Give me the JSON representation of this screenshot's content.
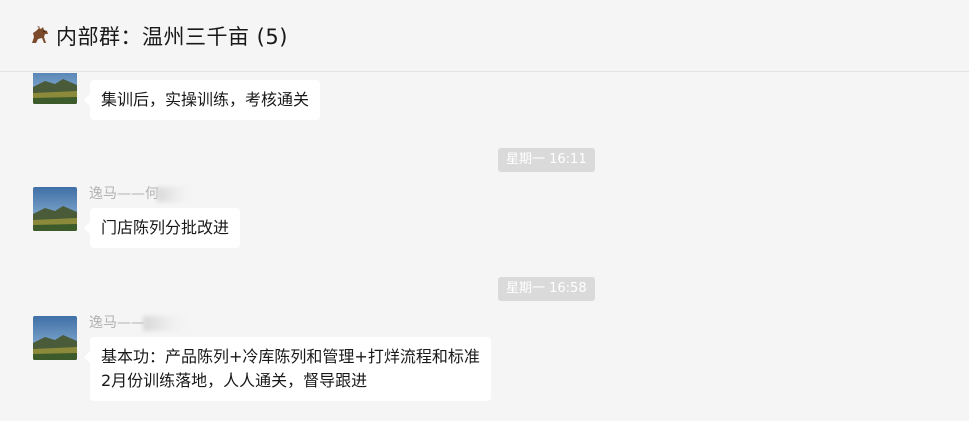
{
  "header": {
    "title": "内部群：温州三千亩 (5)",
    "icon": "horse-icon"
  },
  "messages": [
    {
      "sender": "",
      "lines": [
        "集训后，实操训练，考核通关"
      ]
    },
    {
      "sender": "逸马——何",
      "lines": [
        "门店陈列分批改进"
      ]
    },
    {
      "sender": "逸马——",
      "lines": [
        "基本功：产品陈列+冷库陈列和管理+打烊流程和标准",
        "2月份训练落地，人人通关，督导跟进"
      ]
    }
  ],
  "timestamps": [
    "星期一 16:11",
    "星期一 16:58"
  ],
  "colors": {
    "background": "#f5f5f5",
    "bubble": "#ffffff",
    "timestamp_bg": "#dadada",
    "sender_text": "#b2b2b2"
  }
}
